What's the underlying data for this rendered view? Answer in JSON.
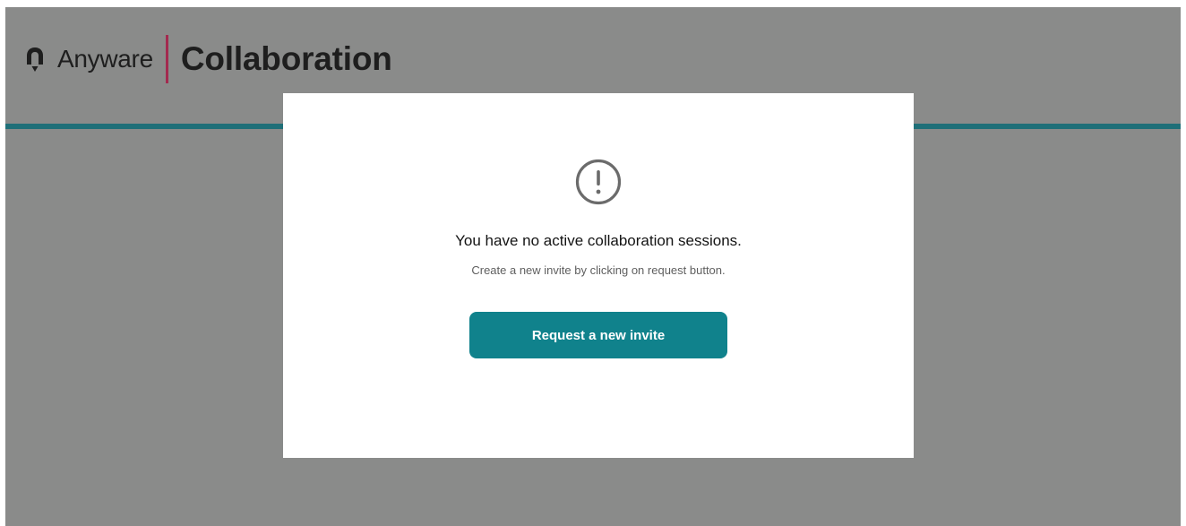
{
  "header": {
    "brand_name": "Anyware",
    "product_name": "Collaboration",
    "logo_icon": "anyware-logo-icon"
  },
  "modal": {
    "icon": "alert-circle-icon",
    "title": "You have no active collaboration sessions.",
    "subtitle": "Create a new invite by clicking on request button.",
    "button_label": "Request a new invite"
  },
  "colors": {
    "overlay": "#8a8b8a",
    "accent_rule": "#1f6f78",
    "brand_divider": "#a32a4f",
    "button": "#10828c",
    "modal_bg": "#ffffff"
  }
}
